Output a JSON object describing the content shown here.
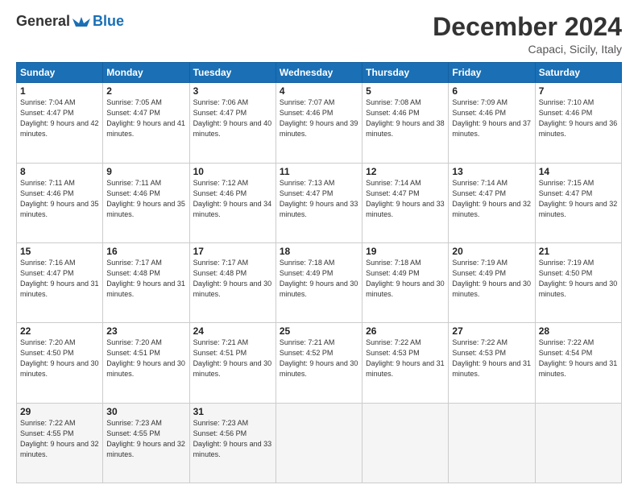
{
  "header": {
    "logo_general": "General",
    "logo_blue": "Blue",
    "month_title": "December 2024",
    "location": "Capaci, Sicily, Italy"
  },
  "weekdays": [
    "Sunday",
    "Monday",
    "Tuesday",
    "Wednesday",
    "Thursday",
    "Friday",
    "Saturday"
  ],
  "weeks": [
    [
      {
        "day": "1",
        "sunrise": "Sunrise: 7:04 AM",
        "sunset": "Sunset: 4:47 PM",
        "daylight": "Daylight: 9 hours and 42 minutes."
      },
      {
        "day": "2",
        "sunrise": "Sunrise: 7:05 AM",
        "sunset": "Sunset: 4:47 PM",
        "daylight": "Daylight: 9 hours and 41 minutes."
      },
      {
        "day": "3",
        "sunrise": "Sunrise: 7:06 AM",
        "sunset": "Sunset: 4:47 PM",
        "daylight": "Daylight: 9 hours and 40 minutes."
      },
      {
        "day": "4",
        "sunrise": "Sunrise: 7:07 AM",
        "sunset": "Sunset: 4:46 PM",
        "daylight": "Daylight: 9 hours and 39 minutes."
      },
      {
        "day": "5",
        "sunrise": "Sunrise: 7:08 AM",
        "sunset": "Sunset: 4:46 PM",
        "daylight": "Daylight: 9 hours and 38 minutes."
      },
      {
        "day": "6",
        "sunrise": "Sunrise: 7:09 AM",
        "sunset": "Sunset: 4:46 PM",
        "daylight": "Daylight: 9 hours and 37 minutes."
      },
      {
        "day": "7",
        "sunrise": "Sunrise: 7:10 AM",
        "sunset": "Sunset: 4:46 PM",
        "daylight": "Daylight: 9 hours and 36 minutes."
      }
    ],
    [
      {
        "day": "8",
        "sunrise": "Sunrise: 7:11 AM",
        "sunset": "Sunset: 4:46 PM",
        "daylight": "Daylight: 9 hours and 35 minutes."
      },
      {
        "day": "9",
        "sunrise": "Sunrise: 7:11 AM",
        "sunset": "Sunset: 4:46 PM",
        "daylight": "Daylight: 9 hours and 35 minutes."
      },
      {
        "day": "10",
        "sunrise": "Sunrise: 7:12 AM",
        "sunset": "Sunset: 4:46 PM",
        "daylight": "Daylight: 9 hours and 34 minutes."
      },
      {
        "day": "11",
        "sunrise": "Sunrise: 7:13 AM",
        "sunset": "Sunset: 4:47 PM",
        "daylight": "Daylight: 9 hours and 33 minutes."
      },
      {
        "day": "12",
        "sunrise": "Sunrise: 7:14 AM",
        "sunset": "Sunset: 4:47 PM",
        "daylight": "Daylight: 9 hours and 33 minutes."
      },
      {
        "day": "13",
        "sunrise": "Sunrise: 7:14 AM",
        "sunset": "Sunset: 4:47 PM",
        "daylight": "Daylight: 9 hours and 32 minutes."
      },
      {
        "day": "14",
        "sunrise": "Sunrise: 7:15 AM",
        "sunset": "Sunset: 4:47 PM",
        "daylight": "Daylight: 9 hours and 32 minutes."
      }
    ],
    [
      {
        "day": "15",
        "sunrise": "Sunrise: 7:16 AM",
        "sunset": "Sunset: 4:47 PM",
        "daylight": "Daylight: 9 hours and 31 minutes."
      },
      {
        "day": "16",
        "sunrise": "Sunrise: 7:17 AM",
        "sunset": "Sunset: 4:48 PM",
        "daylight": "Daylight: 9 hours and 31 minutes."
      },
      {
        "day": "17",
        "sunrise": "Sunrise: 7:17 AM",
        "sunset": "Sunset: 4:48 PM",
        "daylight": "Daylight: 9 hours and 30 minutes."
      },
      {
        "day": "18",
        "sunrise": "Sunrise: 7:18 AM",
        "sunset": "Sunset: 4:49 PM",
        "daylight": "Daylight: 9 hours and 30 minutes."
      },
      {
        "day": "19",
        "sunrise": "Sunrise: 7:18 AM",
        "sunset": "Sunset: 4:49 PM",
        "daylight": "Daylight: 9 hours and 30 minutes."
      },
      {
        "day": "20",
        "sunrise": "Sunrise: 7:19 AM",
        "sunset": "Sunset: 4:49 PM",
        "daylight": "Daylight: 9 hours and 30 minutes."
      },
      {
        "day": "21",
        "sunrise": "Sunrise: 7:19 AM",
        "sunset": "Sunset: 4:50 PM",
        "daylight": "Daylight: 9 hours and 30 minutes."
      }
    ],
    [
      {
        "day": "22",
        "sunrise": "Sunrise: 7:20 AM",
        "sunset": "Sunset: 4:50 PM",
        "daylight": "Daylight: 9 hours and 30 minutes."
      },
      {
        "day": "23",
        "sunrise": "Sunrise: 7:20 AM",
        "sunset": "Sunset: 4:51 PM",
        "daylight": "Daylight: 9 hours and 30 minutes."
      },
      {
        "day": "24",
        "sunrise": "Sunrise: 7:21 AM",
        "sunset": "Sunset: 4:51 PM",
        "daylight": "Daylight: 9 hours and 30 minutes."
      },
      {
        "day": "25",
        "sunrise": "Sunrise: 7:21 AM",
        "sunset": "Sunset: 4:52 PM",
        "daylight": "Daylight: 9 hours and 30 minutes."
      },
      {
        "day": "26",
        "sunrise": "Sunrise: 7:22 AM",
        "sunset": "Sunset: 4:53 PM",
        "daylight": "Daylight: 9 hours and 31 minutes."
      },
      {
        "day": "27",
        "sunrise": "Sunrise: 7:22 AM",
        "sunset": "Sunset: 4:53 PM",
        "daylight": "Daylight: 9 hours and 31 minutes."
      },
      {
        "day": "28",
        "sunrise": "Sunrise: 7:22 AM",
        "sunset": "Sunset: 4:54 PM",
        "daylight": "Daylight: 9 hours and 31 minutes."
      }
    ],
    [
      {
        "day": "29",
        "sunrise": "Sunrise: 7:22 AM",
        "sunset": "Sunset: 4:55 PM",
        "daylight": "Daylight: 9 hours and 32 minutes."
      },
      {
        "day": "30",
        "sunrise": "Sunrise: 7:23 AM",
        "sunset": "Sunset: 4:55 PM",
        "daylight": "Daylight: 9 hours and 32 minutes."
      },
      {
        "day": "31",
        "sunrise": "Sunrise: 7:23 AM",
        "sunset": "Sunset: 4:56 PM",
        "daylight": "Daylight: 9 hours and 33 minutes."
      },
      {
        "day": "",
        "sunrise": "",
        "sunset": "",
        "daylight": ""
      },
      {
        "day": "",
        "sunrise": "",
        "sunset": "",
        "daylight": ""
      },
      {
        "day": "",
        "sunrise": "",
        "sunset": "",
        "daylight": ""
      },
      {
        "day": "",
        "sunrise": "",
        "sunset": "",
        "daylight": ""
      }
    ]
  ]
}
